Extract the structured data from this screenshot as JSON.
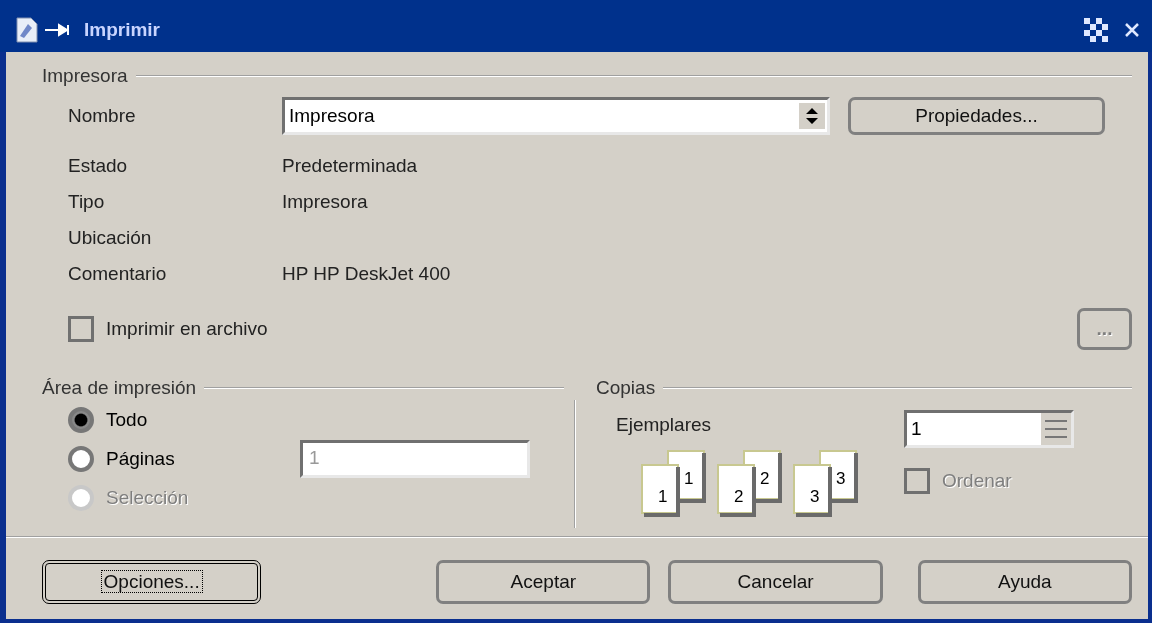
{
  "window": {
    "title": "Imprimir"
  },
  "printer": {
    "section_title": "Impresora",
    "name_label": "Nombre",
    "name_value": "Impresora",
    "properties_button": "Propiedades...",
    "info": [
      {
        "label": "Estado",
        "value": "Predeterminada"
      },
      {
        "label": "Tipo",
        "value": "Impresora"
      },
      {
        "label": "Ubicación"
      },
      {
        "label": "Comentario",
        "value": "HP HP DeskJet 400"
      }
    ],
    "print_to_file": {
      "label": "Imprimir en archivo",
      "checked": false
    },
    "browse_button": {
      "label": "...",
      "disabled": true
    }
  },
  "print_range": {
    "title": "Área de impresión",
    "options": [
      {
        "label": "Todo",
        "selected": true,
        "disabled": false
      },
      {
        "label": "Páginas",
        "selected": false,
        "disabled": false
      },
      {
        "label": "Selección",
        "selected": false,
        "disabled": true
      }
    ],
    "pages_value": "1"
  },
  "copies": {
    "title": "Copias",
    "count_label": "Ejemplares",
    "count_value": "1",
    "collate_pages": [
      {
        "back": "1",
        "front": "1"
      },
      {
        "back": "2",
        "front": "2"
      },
      {
        "back": "3",
        "front": "3"
      }
    ],
    "collate": {
      "label": "Ordenar",
      "checked": false,
      "disabled": true
    }
  },
  "buttons": [
    {
      "label": "Opciones...",
      "focused": true
    },
    {
      "label": "Aceptar",
      "focused": false
    },
    {
      "label": "Cancelar",
      "focused": false
    },
    {
      "label": "Ayuda",
      "focused": false
    }
  ]
}
